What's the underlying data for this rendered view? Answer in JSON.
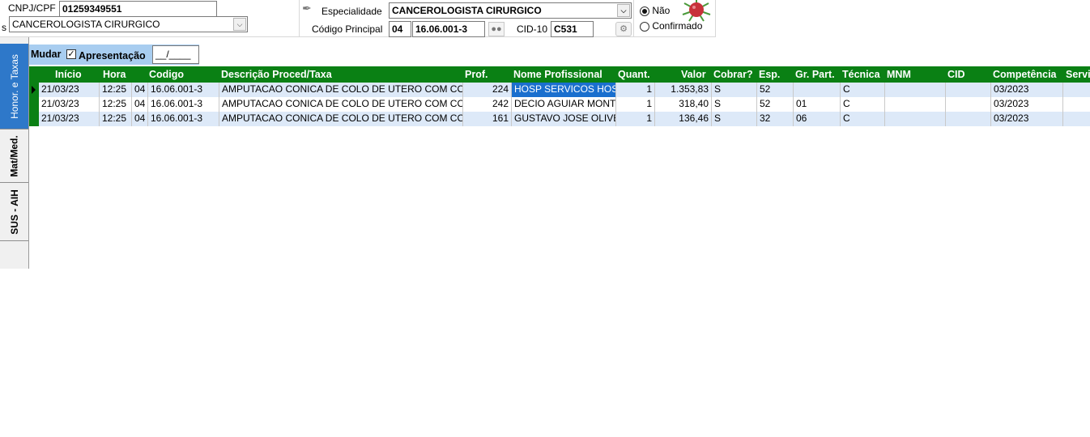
{
  "top_left": {
    "cnpj_label": "CNPJ/CPF",
    "cnpj_value": "01259349551",
    "side_label": "s",
    "especialidade_value": "CANCEROLOGISTA CIRURGICO"
  },
  "top_mid": {
    "especialidade_label": "Especialidade",
    "especialidade_value": "CANCEROLOGISTA CIRURGICO",
    "codigo_principal_label": "Código Principal",
    "codigo_group": "04",
    "codigo_value": "16.06.001-3",
    "cid_label": "CID-10",
    "cid_value": "C531"
  },
  "top_right": {
    "radio_nao_label": "Não",
    "radio_confirmado_label": "Confirmado",
    "selected": "Não"
  },
  "tabs": [
    "Honor. e Taxas",
    "Mat/Med.",
    "SUS - AIH"
  ],
  "filter": {
    "mudar_label": "Mudar",
    "apresentacao_label": "Apresentação",
    "apresentacao_value": "__/____",
    "checked": true
  },
  "grid": {
    "columns": [
      "Início",
      "Hora",
      "Codigo",
      "Descrição Proced/Taxa",
      "Prof.",
      "Nome Profissional",
      "Quant.",
      "Valor",
      "Cobrar?",
      "Esp.",
      "Gr. Part.",
      "Técnica",
      "MNM",
      "CID",
      "Competência",
      "Servi"
    ],
    "rows": [
      [
        "21/03/23",
        "12:25",
        "04",
        "16.06.001-3",
        "AMPUTACAO CONICA DE COLO DE UTERO COM COL",
        "224",
        "HOSP SERVICOS HOS",
        "1",
        "1.353,83",
        "S",
        "52",
        "",
        "C",
        "",
        "",
        "03/2023"
      ],
      [
        "21/03/23",
        "12:25",
        "04",
        "16.06.001-3",
        "AMPUTACAO CONICA DE COLO DE UTERO COM COL",
        "242",
        "DECIO AGUIAR MONTE",
        "1",
        "318,40",
        "S",
        "52",
        "01",
        "C",
        "",
        "",
        "03/2023"
      ],
      [
        "21/03/23",
        "12:25",
        "04",
        "16.06.001-3",
        "AMPUTACAO CONICA DE COLO DE UTERO COM COL",
        "161",
        "GUSTAVO JOSE OLIVE",
        "1",
        "136,46",
        "S",
        "32",
        "06",
        "C",
        "",
        "",
        "03/2023"
      ]
    ]
  },
  "icons": [
    "dropper-icon",
    "binoculars-icon",
    "gear-icon",
    "virus-logo-icon",
    "chevron-down-icon",
    "row-pointer-icon",
    "checkbox-check-icon"
  ],
  "colors": {
    "header_green": "#0a8014",
    "selection_blue": "#1a6fce",
    "alt_row": "#dde9f8",
    "tab_active": "#2e78c9",
    "filter_bar": "#a8cdf0"
  }
}
